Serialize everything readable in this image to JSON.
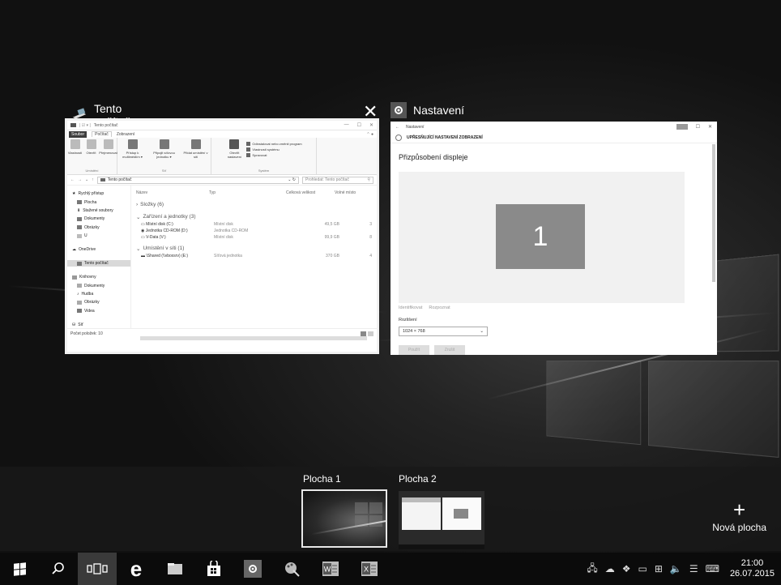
{
  "task_view": {
    "windows": [
      {
        "title": "Tento počítač",
        "close_icon": "close-icon"
      },
      {
        "title": "Nastavení"
      }
    ]
  },
  "explorer": {
    "titlebar": "Tento počítač",
    "tabs": [
      "Soubor",
      "Počítač",
      "Zobrazení"
    ],
    "ribbon": {
      "umisteni": {
        "buttons": [
          "Vlastnosti",
          "Otevřít",
          "Přejmenovat"
        ],
        "caption": "Umístění"
      },
      "sit": {
        "buttons": [
          "Přístup k multimédiím ▾",
          "Připojit síťovou jednotku ▾",
          "Přidat umístění v síti"
        ],
        "caption": "Síť"
      },
      "system": {
        "open_label": "Otevřít nastavení",
        "items": [
          "Odinstalovat nebo změnit program",
          "Vlastnosti systému",
          "Spravovat"
        ],
        "caption": "Systém"
      }
    },
    "address": "Tento počítač",
    "search_placeholder": "Prohledat: Tento počítač",
    "nav": [
      "Rychlý přístup",
      "Plocha",
      "Stažené soubory",
      "Dokumenty",
      "Obrázky",
      "U",
      "OneDrive",
      "Tento počítač",
      "Knihovny",
      "Dokumenty",
      "Hudba",
      "Obrázky",
      "Videa",
      "Síť"
    ],
    "columns": [
      "Název",
      "Typ",
      "Celková velikost",
      "Volné místo"
    ],
    "groups": {
      "folders": "Složky (6)",
      "devices": "Zařízení a jednotky (3)",
      "network": "Umístění v síti (1)"
    },
    "rows": [
      {
        "name": "Místní disk (C:)",
        "type": "Místní disk",
        "size": "49,5 GB",
        "free": "3"
      },
      {
        "name": "Jednotka CD-ROM (D:)",
        "type": "Jednotka CD-ROM",
        "size": "",
        "free": ""
      },
      {
        "name": "V-Data (V:)",
        "type": "Místní disk",
        "size": "99,9 GB",
        "free": "8"
      },
      {
        "name": "\\Shared (\\\\vboxsrv) (E:)",
        "type": "Síťová jednotka",
        "size": "370 GB",
        "free": "4"
      }
    ],
    "status": "Počet položek: 10"
  },
  "settings": {
    "titlebar": "Nastavení",
    "header": "UPŘESŇUJÍCÍ NASTAVENÍ ZOBRAZENÍ",
    "section": "Přizpůsobení displeje",
    "monitor": "1",
    "links": [
      "Identifikovat",
      "Rozpoznat"
    ],
    "resolution_label": "Rozlišení",
    "resolution_value": "1024 × 768",
    "buttons": [
      "Použít",
      "Zrušit"
    ]
  },
  "desktops": {
    "items": [
      "Plocha 1",
      "Plocha 2"
    ],
    "active": "Plocha 1",
    "new_label": "Nová plocha"
  },
  "taskbar": {
    "apps": [
      "start-icon",
      "search-icon",
      "task-view-icon",
      "edge-icon",
      "file-explorer-icon",
      "store-icon",
      "settings-icon",
      "paint-icon",
      "word-icon",
      "excel-icon"
    ],
    "clock_time": "21:00",
    "clock_date": "26.07.2015"
  }
}
